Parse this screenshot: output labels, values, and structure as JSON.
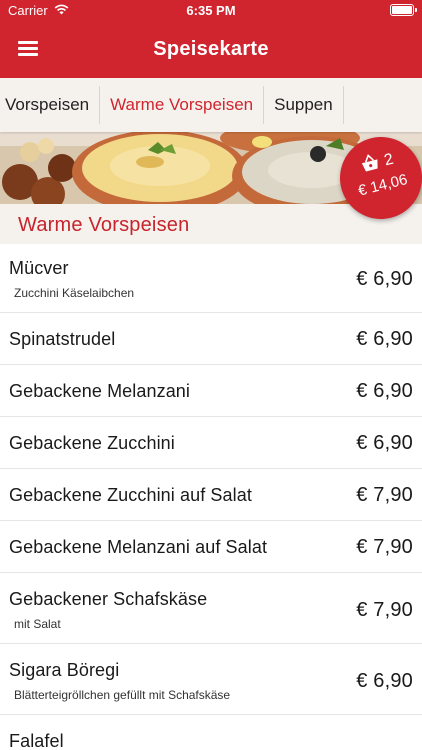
{
  "status_bar": {
    "carrier": "Carrier",
    "time": "6:35 PM"
  },
  "nav": {
    "title": "Speisekarte"
  },
  "tabs": [
    {
      "label": "Vorspeisen"
    },
    {
      "label": "Warme Vorspeisen"
    },
    {
      "label": "Suppen"
    }
  ],
  "cart": {
    "count": "2",
    "total": "€ 14,06"
  },
  "section": {
    "title": "Warme Vorspeisen"
  },
  "items": [
    {
      "name": "Mücver",
      "description": "Zucchini Käselaibchen",
      "price": "€ 6,90"
    },
    {
      "name": "Spinatstrudel",
      "description": "",
      "price": "€ 6,90"
    },
    {
      "name": "Gebackene Melanzani",
      "description": "",
      "price": "€ 6,90"
    },
    {
      "name": "Gebackene Zucchini",
      "description": "",
      "price": "€ 6,90"
    },
    {
      "name": "Gebackene Zucchini auf Salat",
      "description": "",
      "price": "€ 7,90"
    },
    {
      "name": "Gebackene Melanzani auf Salat",
      "description": "",
      "price": "€ 7,90"
    },
    {
      "name": "Gebackener Schafskäse",
      "description": "mit Salat",
      "price": "€ 7,90"
    },
    {
      "name": "Sigara Böregi",
      "description": "Blätterteigröllchen gefüllt mit Schafskäse",
      "price": "€ 6,90"
    },
    {
      "name": "Falafel",
      "description": "",
      "price": ""
    }
  ],
  "colors": {
    "brand_red": "#d0252f",
    "section_bg": "#f5f2ee"
  },
  "icons": {
    "menu": "hamburger-icon",
    "cart": "basket-icon",
    "wifi": "wifi-icon",
    "battery": "battery-icon"
  }
}
